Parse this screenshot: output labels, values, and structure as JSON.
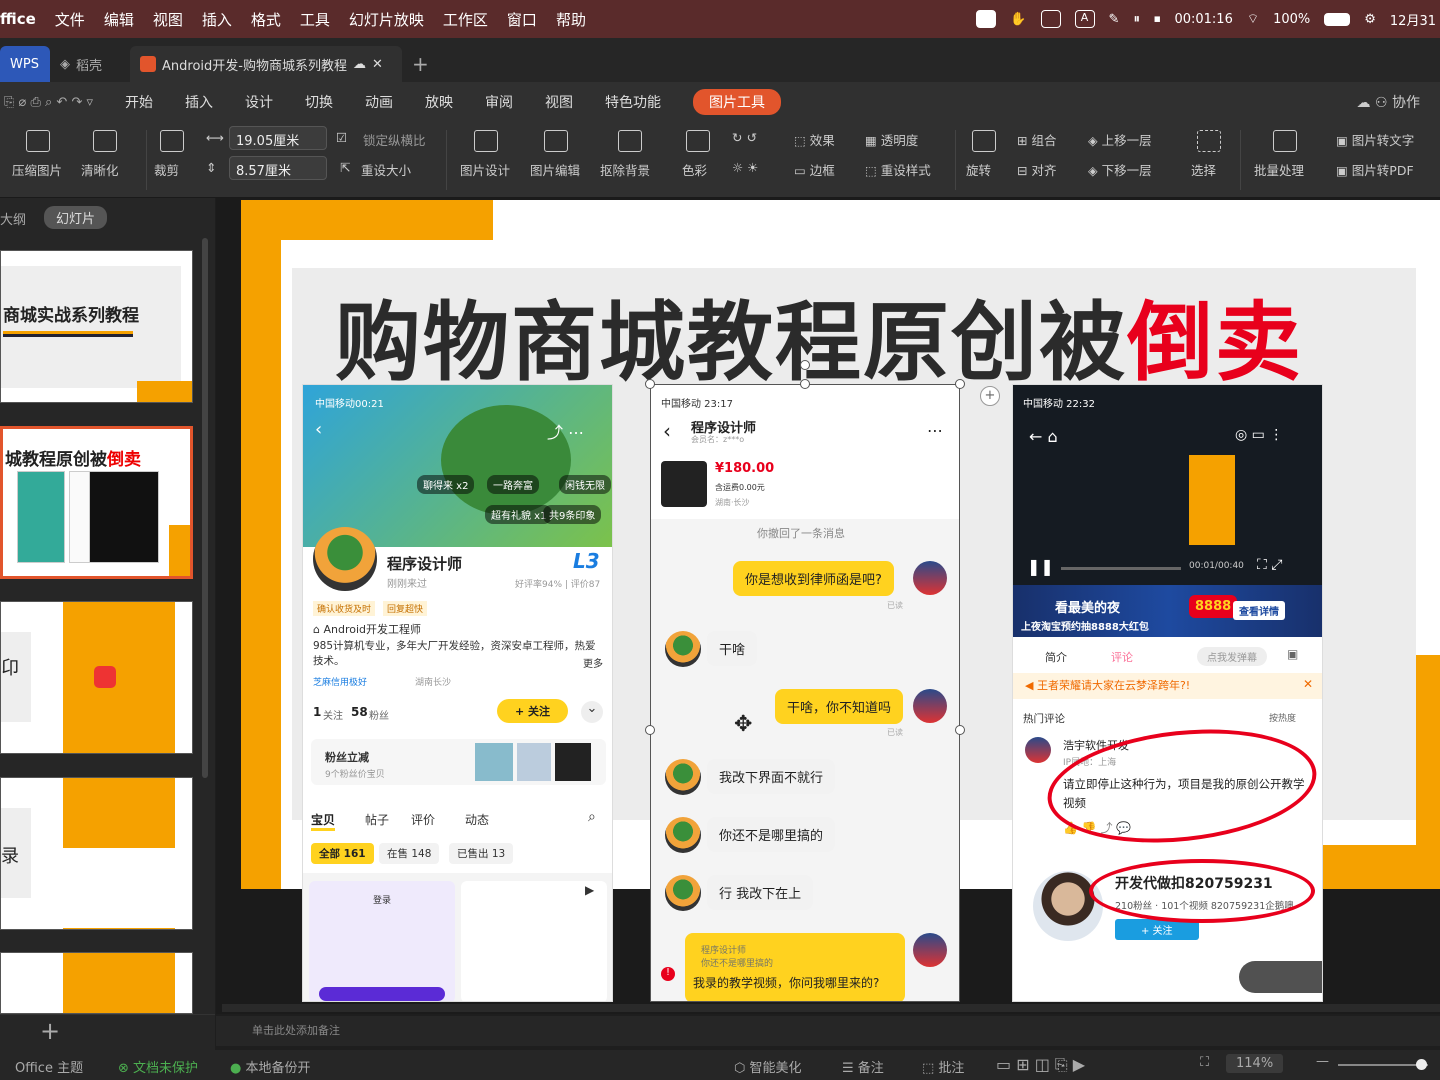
{
  "menubar": {
    "items": [
      "ffice",
      "文件",
      "编辑",
      "视图",
      "插入",
      "格式",
      "工具",
      "幻灯片放映",
      "工作区",
      "窗口",
      "帮助"
    ],
    "timer": "00:01:16",
    "battery": "100%",
    "date": "12月31"
  },
  "tabs": {
    "wps": "WPS",
    "daoke": "稻壳",
    "doc": "Android开发-购物商城系列教程",
    "add": "+"
  },
  "ribbon_tabs": [
    "开始",
    "插入",
    "设计",
    "切换",
    "动画",
    "放映",
    "审阅",
    "视图",
    "特色功能",
    "图片工具"
  ],
  "ribbon_right": {
    "collab": "协作"
  },
  "toolbar": {
    "compress": "压缩图片",
    "clarify": "清晰化",
    "crop": "裁剪",
    "width": "19.05厘米",
    "height": "8.57厘米",
    "lock_ratio": "锁定纵横比",
    "resize": "重设大小",
    "pic_design": "图片设计",
    "pic_edit": "图片编辑",
    "remove_bg": "抠除背景",
    "color": "色彩",
    "effect": "效果",
    "transparency": "透明度",
    "border": "边框",
    "reset_style": "重设样式",
    "rotate": "旋转",
    "group": "组合",
    "align": "对齐",
    "up_layer": "上移一层",
    "down_layer": "下移一层",
    "select": "选择",
    "batch": "批量处理",
    "pic_to_text": "图片转文字",
    "pic_to_pdf": "图片转PDF"
  },
  "sidebar": {
    "outline": "大纲",
    "slides": "幻灯片",
    "thumb1": "商城实战系列教程",
    "thumb2a": "城教程原创被",
    "thumb2b": "倒卖",
    "add": "+"
  },
  "slide": {
    "title_black": "购物商城教程原创被",
    "title_red": "倒卖"
  },
  "phone1": {
    "status": "中国移动00:21",
    "tag1": "聊得来 x2",
    "tag2": "一路奔富",
    "tag3": "闲钱无限",
    "tag4": "超有礼貌 x1",
    "tag5": "共9条印象",
    "name": "程序设计师",
    "sub": "刚刚来过",
    "level": "L3",
    "rating": "好评率94% | 评价87",
    "badge1": "确认收货及时",
    "badge2": "回复超快",
    "job": "Android开发工程师",
    "bio": "985计算机专业，多年大厂开发经验，资深安卓工程师，热爱技术。",
    "more": "更多",
    "credit": "芝麻信用极好",
    "loc": "湖南长沙",
    "follow_n": "1",
    "follow_l": "关注",
    "fans_n": "58",
    "fans_l": "粉丝",
    "follow_btn": "+ 关注",
    "fans_coupon": "粉丝立减",
    "coupon_sub": "9个粉丝价宝贝",
    "tab1": "宝贝",
    "tab2": "帖子",
    "tab3": "评价",
    "tab4": "动态",
    "f1": "全部 161",
    "f2": "在售 148",
    "f3": "已售出 13",
    "login": "登录"
  },
  "phone2": {
    "status": "中国移动 23:17",
    "name": "程序设计师",
    "member": "会员名：z***o",
    "price": "¥180.00",
    "fee": "含运费0.00元",
    "loc": "湖南·长沙",
    "recall": "你撤回了一条消息",
    "m1": "你是想收到律师函是吧?",
    "read": "已读",
    "m2": "干啥",
    "m3": "干啥，你不知道吗",
    "m4": "我改下界面不就行",
    "m5": "你还不是哪里搞的",
    "m6": "行 我改下在上",
    "q1": "程序设计师",
    "q2": "你还不是哪里搞的",
    "m7": "我录的教学视频，你问我哪里来的?"
  },
  "phone3": {
    "status": "中国移动 22:32",
    "time": "00:01/00:40",
    "ad": "看最美的夜",
    "ad_sub": "上夜淘宝预约抽8888大红包",
    "ad_num": "8888",
    "ad_btn": "查看详情",
    "t1": "简介",
    "t2": "评论",
    "t3": "点我发弹幕",
    "notice": "王者荣耀请大家在云梦泽跨年?!",
    "hot": "热门评论",
    "sort": "按热度",
    "user": "浩宇软件开发",
    "ip": "IP属地：上海",
    "comment": "请立即停止这种行为，项目是我的原创公开教学视频",
    "dev": "开发代做扣820759231",
    "dev_sub": "210粉丝 · 101个视频 820759231企鹅噢",
    "follow": "+ 关注"
  },
  "notes": "单击此处添加备注",
  "status": {
    "theme": "Office 主题",
    "protect": "文档未保护",
    "backup": "本地备份开",
    "beautify": "智能美化",
    "notes": "备注",
    "comment": "批注",
    "zoom": "114%"
  }
}
